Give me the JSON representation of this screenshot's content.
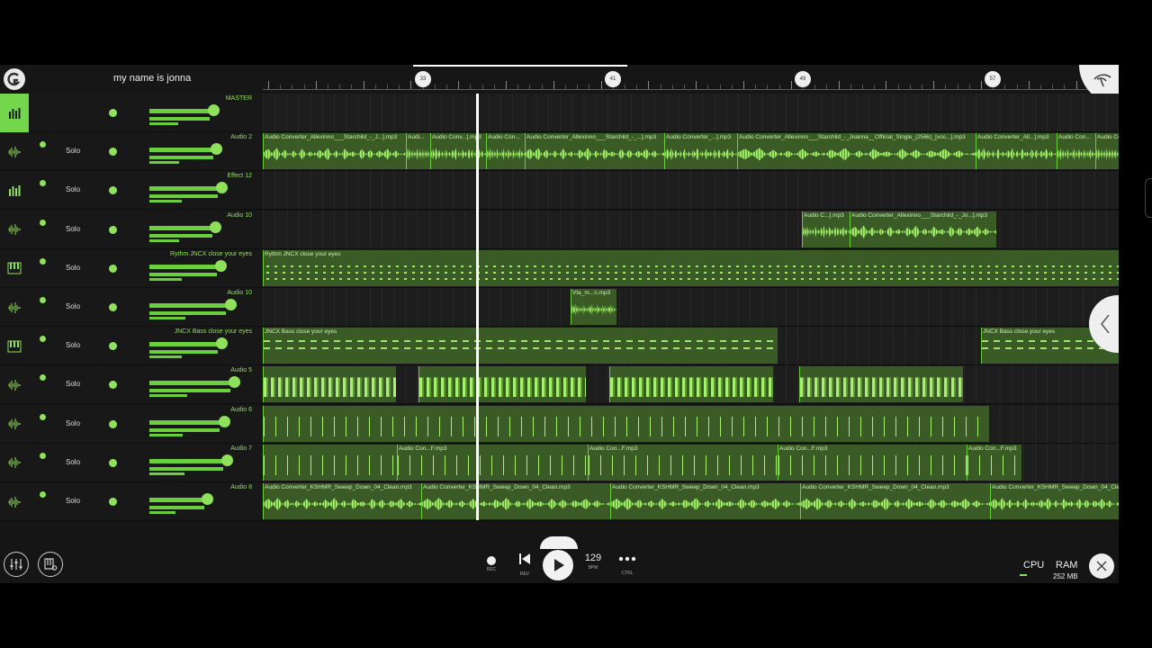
{
  "project": {
    "name": "my name is jonna"
  },
  "ruler": {
    "markers": [
      "33",
      "41",
      "49",
      "57"
    ]
  },
  "tracks": [
    {
      "type": "master",
      "name": "MASTER",
      "icon": "mixer-bars-icon",
      "solo": "",
      "volume": 0.6,
      "clips": []
    },
    {
      "type": "audio",
      "name": "Audio 2",
      "icon": "waveform-icon",
      "solo": "Solo",
      "volume": 0.63,
      "clips": [
        {
          "name": "Audio Converter_Allexinno___Starchild_-_J...].mp3",
          "start": 0,
          "end": 159,
          "kind": "wave"
        },
        {
          "name": "Audi...",
          "start": 159,
          "end": 186,
          "kind": "wave"
        },
        {
          "name": "Audio Conv...].mp3",
          "start": 186,
          "end": 248,
          "kind": "wave"
        },
        {
          "name": "Audio Con...",
          "start": 248,
          "end": 291,
          "kind": "wave"
        },
        {
          "name": "Audio Converter_Allexinno___Starchild_-_...].mp3",
          "start": 291,
          "end": 446,
          "kind": "wave"
        },
        {
          "name": "Audio Converter_...].mp3",
          "start": 446,
          "end": 527,
          "kind": "wave"
        },
        {
          "name": "Audio Converter_Allexinno___Starchild_-_Joanna__Official_Single_(256k)_[voc...].mp3",
          "start": 527,
          "end": 792,
          "kind": "wave"
        },
        {
          "name": "Audio Converter_All...].mp3",
          "start": 792,
          "end": 882,
          "kind": "wave"
        },
        {
          "name": "Audio Con...",
          "start": 882,
          "end": 925,
          "kind": "wave"
        },
        {
          "name": "Audio Co",
          "start": 925,
          "end": 951,
          "kind": "wave"
        }
      ]
    },
    {
      "type": "effect",
      "name": "Effect 12",
      "icon": "mixer-bars-icon",
      "solo": "Solo",
      "volume": 0.68,
      "clips": []
    },
    {
      "type": "audio",
      "name": "Audio 10",
      "icon": "waveform-icon",
      "solo": "Solo",
      "volume": 0.62,
      "clips": [
        {
          "name": "Audio C...].mp3",
          "start": 599,
          "end": 652,
          "kind": "wave"
        },
        {
          "name": "Audio Converter_Allexinno___Starchild_-_Jo...].mp3",
          "start": 652,
          "end": 815,
          "kind": "wave"
        }
      ]
    },
    {
      "type": "midi",
      "name": "Rythm JNCX close your eyes",
      "icon": "piano-keys-icon",
      "solo": "Solo",
      "volume": 0.67,
      "clips": [
        {
          "name": "Rythm JNCX close your eyes",
          "start": 0,
          "end": 951,
          "kind": "notes"
        }
      ]
    },
    {
      "type": "audio",
      "name": "Audio 10",
      "icon": "waveform-icon",
      "solo": "Solo",
      "volume": 0.76,
      "clips": [
        {
          "name": "Vta_m...n.mp3",
          "start": 342,
          "end": 393,
          "kind": "wave"
        }
      ]
    },
    {
      "type": "midi",
      "name": "JNCX Bass close your eyes",
      "icon": "piano-keys-icon",
      "solo": "Solo",
      "volume": 0.68,
      "clips": [
        {
          "name": "JNCX Bass close your eyes",
          "start": 0,
          "end": 572,
          "kind": "bass"
        },
        {
          "name": "JNCX Bass close your eyes",
          "start": 798,
          "end": 951,
          "kind": "bass"
        }
      ]
    },
    {
      "type": "audio",
      "name": "Audio 5",
      "icon": "waveform-icon",
      "solo": "Solo",
      "volume": 0.8,
      "clips": [
        {
          "name": "",
          "start": 0,
          "end": 148,
          "kind": "hits"
        },
        {
          "name": "",
          "start": 173,
          "end": 359,
          "kind": "hits"
        },
        {
          "name": "",
          "start": 385,
          "end": 567,
          "kind": "hits"
        },
        {
          "name": "",
          "start": 596,
          "end": 778,
          "kind": "hits"
        }
      ]
    },
    {
      "type": "audio",
      "name": "Audio 6",
      "icon": "waveform-icon",
      "solo": "Solo",
      "volume": 0.7,
      "clips": [
        {
          "name": "",
          "start": 0,
          "end": 807,
          "kind": "spikes"
        }
      ]
    },
    {
      "type": "audio",
      "name": "Audio 7",
      "icon": "waveform-icon",
      "solo": "Solo",
      "volume": 0.73,
      "clips": [
        {
          "name": "",
          "start": 0,
          "end": 149,
          "kind": "spikes"
        },
        {
          "name": "Audio Con...F.mp3",
          "start": 149,
          "end": 361,
          "kind": "spikes"
        },
        {
          "name": "Audio Con...F.mp3",
          "start": 361,
          "end": 572,
          "kind": "spikes"
        },
        {
          "name": "Audio Con...F.mp3",
          "start": 572,
          "end": 782,
          "kind": "spikes"
        },
        {
          "name": "Audio Con...F.mp3",
          "start": 782,
          "end": 843,
          "kind": "spikes"
        }
      ]
    },
    {
      "type": "audio",
      "name": "Audio 8",
      "icon": "waveform-icon",
      "solo": "Solo",
      "volume": 0.54,
      "clips": [
        {
          "name": "Audio Converter_KSHMR_Sweep_Down_04_Clean.mp3",
          "start": 0,
          "end": 176,
          "kind": "wave"
        },
        {
          "name": "Audio Converter_KSHMR_Sweep_Down_04_Clean.mp3",
          "start": 176,
          "end": 386,
          "kind": "wave"
        },
        {
          "name": "Audio Converter_KSHMR_Sweep_Down_04_Clean.mp3",
          "start": 386,
          "end": 597,
          "kind": "wave"
        },
        {
          "name": "Audio Converter_KSHMR_Sweep_Down_04_Clean.mp3",
          "start": 597,
          "end": 808,
          "kind": "wave"
        },
        {
          "name": "Audio Converter_KSHMR_Sweep_Down_04_Cle",
          "start": 808,
          "end": 951,
          "kind": "wave"
        }
      ]
    }
  ],
  "transport": {
    "rec_label": "REC",
    "rev_label": "REV",
    "bpm": "129",
    "bpm_label": "BPM",
    "ctrl_label": "CTRL"
  },
  "status": {
    "cpu_label": "CPU",
    "ram_label": "RAM",
    "ram_value": "252 MB"
  },
  "colors": {
    "accent": "#8fe05a",
    "clip_bg": "#3a5a26",
    "background": "#151515"
  }
}
